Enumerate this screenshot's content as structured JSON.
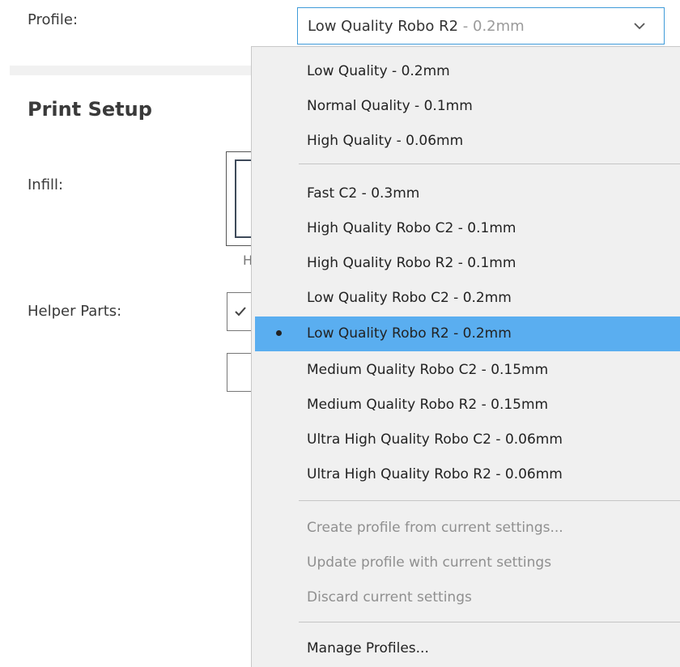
{
  "profile": {
    "label": "Profile:",
    "selected_name": "Low Quality Robo R2",
    "selected_suffix": " - 0.2mm"
  },
  "section": {
    "title": "Print Setup"
  },
  "fields": {
    "infill_label": "Infill:",
    "helper_parts_label": "Helper Parts:",
    "infill_partial_text": "H"
  },
  "menu": {
    "items": [
      {
        "label": "Low Quality - 0.2mm"
      },
      {
        "label": "Normal Quality - 0.1mm"
      },
      {
        "label": "High Quality - 0.06mm"
      },
      {
        "label": "Fast C2 - 0.3mm"
      },
      {
        "label": "High Quality Robo C2 - 0.1mm"
      },
      {
        "label": "High Quality Robo R2 - 0.1mm"
      },
      {
        "label": "Low Quality Robo C2 - 0.2mm"
      },
      {
        "label": "Low Quality Robo R2 - 0.2mm",
        "selected": true
      },
      {
        "label": "Medium Quality Robo C2 - 0.15mm"
      },
      {
        "label": "Medium Quality Robo R2 - 0.15mm"
      },
      {
        "label": "Ultra High Quality Robo C2 - 0.06mm"
      },
      {
        "label": "Ultra High Quality Robo R2 - 0.06mm"
      },
      {
        "label": "Create profile from current settings...",
        "disabled": true
      },
      {
        "label": "Update profile with current settings",
        "disabled": true
      },
      {
        "label": "Discard current settings",
        "disabled": true
      },
      {
        "label": "Manage Profiles..."
      }
    ]
  },
  "colors": {
    "accent": "#3f9bd9",
    "selected_bg": "#5aaef0",
    "menu_bg": "#f0f0f0",
    "disabled_text": "#8f8f8f"
  }
}
